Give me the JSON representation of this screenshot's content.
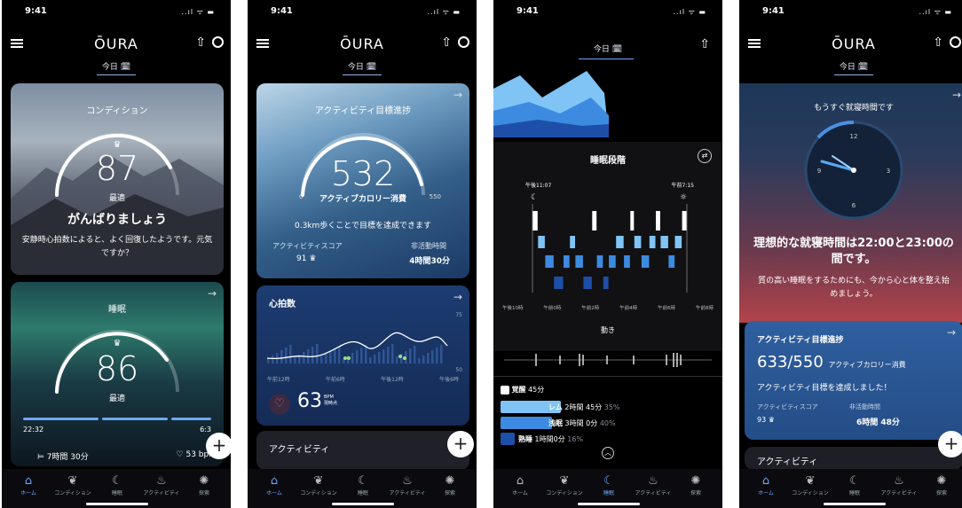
{
  "status": {
    "time": "9:41",
    "signal": "..ıl ᯤ ▬"
  },
  "header": {
    "logo": "ŌURA",
    "today": "今日 🗓"
  },
  "tabs": [
    "ホーム",
    "コンディション",
    "睡眠",
    "アクティビティ",
    "探索"
  ],
  "screen1": {
    "readiness": {
      "title": "コンディション",
      "score": "87",
      "status": "最適",
      "headline": "がんばりましょう",
      "body": "安静時心拍数によると、よく回復したようです。元気ですか？"
    },
    "sleep": {
      "title": "睡眠",
      "score": "86",
      "status": "最適",
      "start": "22:32",
      "end": "6:3",
      "duration": "7時間 30分",
      "hr": "53 bpm"
    }
  },
  "screen2": {
    "activity": {
      "title": "アクティビティ目標進捗",
      "score": "532",
      "unit": "アクティブカロリー消費",
      "min": "0",
      "max": "550",
      "message": "0.3km歩くことで目標を達成できます",
      "score_label": "アクティビティスコア",
      "score_value": "91",
      "inactive_label": "非活動時間",
      "inactive_value": "4時間30分"
    },
    "heart": {
      "title": "心拍数",
      "y_top": "75",
      "y_bottom": "50",
      "x_labels": [
        "午前12時",
        "午前6時",
        "午後12時",
        "午後6時"
      ],
      "value": "63",
      "unit_top": "BPM",
      "unit_bottom": "現時点"
    },
    "activity2": {
      "title": "アクティビティ"
    }
  },
  "screen3": {
    "stages": {
      "title": "睡眠段階",
      "bed": "午後11:07",
      "wake": "午前7:15",
      "x_labels": [
        "午後10時",
        "午前0時",
        "午前2時",
        "午前4時",
        "午前6時",
        "午前8時"
      ],
      "movement": "動き"
    },
    "legend": [
      {
        "label": "覚醒",
        "value": "45分",
        "pct": ""
      },
      {
        "label": "レム",
        "value": "2時間 45分",
        "pct": "35%"
      },
      {
        "label": "浅眠",
        "value": "3時間 0分",
        "pct": "40%"
      },
      {
        "label": "熟睡",
        "value": "1時間0分",
        "pct": "16%"
      }
    ],
    "hypnogram": [
      {
        "s": 0,
        "d": 0.35
      },
      {
        "s": 1,
        "d": 0.45
      },
      {
        "s": 2,
        "d": 0.55
      },
      {
        "s": 3,
        "d": 0.6
      },
      {
        "s": 2,
        "d": 0.4
      },
      {
        "s": 1,
        "d": 0.35
      },
      {
        "s": 2,
        "d": 0.5
      },
      {
        "s": 3,
        "d": 0.55
      },
      {
        "s": 0,
        "d": 0.3
      },
      {
        "s": 2,
        "d": 0.4
      },
      {
        "s": 3,
        "d": 0.35
      },
      {
        "s": 2,
        "d": 0.45
      },
      {
        "s": 1,
        "d": 0.5
      },
      {
        "s": 2,
        "d": 0.4
      },
      {
        "s": 0,
        "d": 0.25
      },
      {
        "s": 1,
        "d": 0.45
      },
      {
        "s": 2,
        "d": 0.5
      },
      {
        "s": 1,
        "d": 0.4
      },
      {
        "s": 0,
        "d": 0.3
      },
      {
        "s": 1,
        "d": 0.5
      },
      {
        "s": 2,
        "d": 0.4
      },
      {
        "s": 1,
        "d": 0.45
      },
      {
        "s": 0,
        "d": 0.3
      }
    ]
  },
  "screen4": {
    "bedtime": {
      "title": "もうすぐ就寝時間です",
      "headline": "理想的な就寝時間は22:00と23:00の間です。",
      "body": "質の高い睡眠をするためにも、今から心と体を整え始めましょう。",
      "clock": [
        "12",
        "3",
        "6",
        "9"
      ]
    },
    "activity": {
      "title": "アクティビティ目標進捗",
      "value": "633/550",
      "unit": "アクティブカロリー消費",
      "message": "アクティビティ目標を達成しました！",
      "score_label": "アクティビティスコア",
      "score_value": "93",
      "inactive_label": "非活動時間",
      "inactive_value": "6時間 48分"
    },
    "activity2": {
      "title": "アクティビティ"
    }
  },
  "colors": {
    "accent": "#6ea6ff",
    "rem": "#7fc4f5",
    "light": "#3d8be0",
    "deep": "#1e4fa8",
    "awake": "#ffffff",
    "heart_red": "#e8605a"
  }
}
